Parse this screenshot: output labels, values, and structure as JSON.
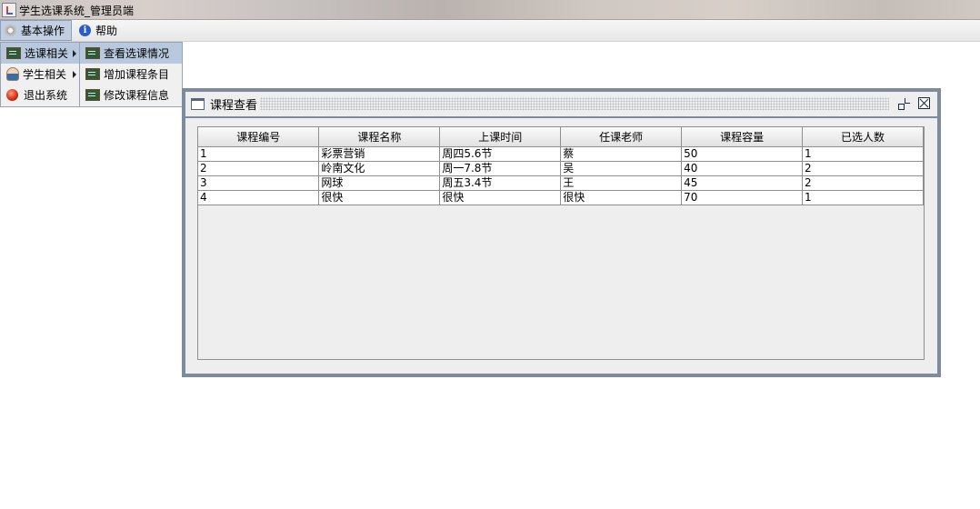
{
  "window": {
    "title": "学生选课系统_管理员端"
  },
  "menubar": {
    "items": [
      {
        "label": "基本操作",
        "icon": "gear-icon"
      },
      {
        "label": "帮助",
        "icon": "info-icon"
      }
    ]
  },
  "menu_basic": {
    "items": [
      {
        "label": "选课相关",
        "icon": "blackboard-icon",
        "submenu": true
      },
      {
        "label": "学生相关",
        "icon": "person-icon",
        "submenu": true
      },
      {
        "label": "退出系统",
        "icon": "exit-icon",
        "submenu": false
      }
    ]
  },
  "submenu_course": {
    "items": [
      {
        "label": "查看选课情况",
        "icon": "blackboard-icon"
      },
      {
        "label": "增加课程条目",
        "icon": "blackboard-icon"
      },
      {
        "label": "修改课程信息",
        "icon": "blackboard-icon"
      }
    ]
  },
  "internal_frame": {
    "title": "课程查看",
    "table": {
      "columns": [
        "课程编号",
        "课程名称",
        "上课时间",
        "任课老师",
        "课程容量",
        "已选人数"
      ],
      "rows": [
        [
          "1",
          "彩票营销",
          "周四5.6节",
          "蔡",
          "50",
          "1"
        ],
        [
          "2",
          "岭南文化",
          "周一7.8节",
          "吴",
          "40",
          "2"
        ],
        [
          "3",
          "网球",
          "周五3.4节",
          "王",
          "45",
          "2"
        ],
        [
          "4",
          "很快",
          "很快",
          "很快",
          "70",
          "1"
        ]
      ]
    }
  }
}
